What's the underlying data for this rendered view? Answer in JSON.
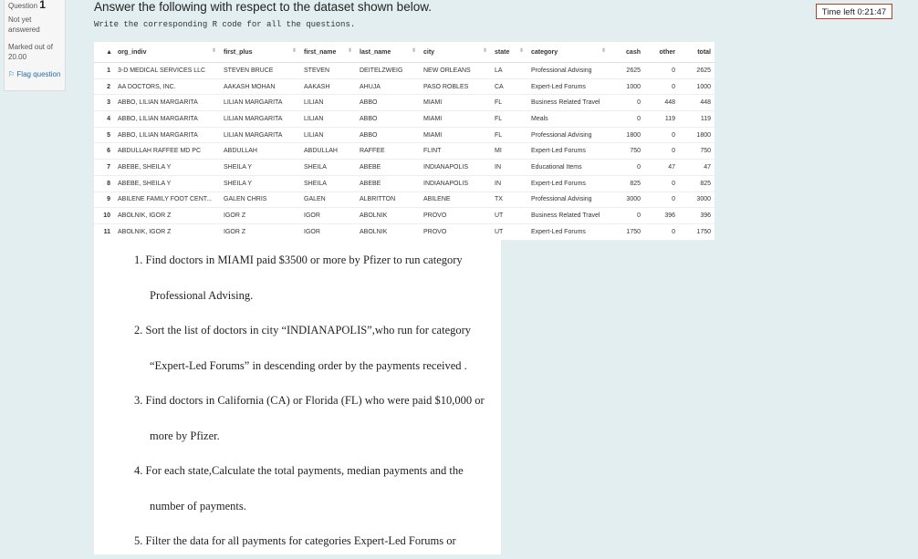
{
  "question_info": {
    "label": "Question",
    "number": "1",
    "status": "Not yet answered",
    "marks": "Marked out of 20.00",
    "flag": "Flag question"
  },
  "heading": "Answer the following with respect to the dataset shown below.",
  "subheading": "Write the corresponding R code for all the questions.",
  "timer": "Time left 0:21:47",
  "table": {
    "columns": [
      "org_indiv",
      "first_plus",
      "first_name",
      "last_name",
      "city",
      "state",
      "category",
      "cash",
      "other",
      "total"
    ],
    "rows": [
      [
        "1",
        "3-D MEDICAL SERVICES LLC",
        "STEVEN BRUCE",
        "STEVEN",
        "DEITELZWEIG",
        "NEW ORLEANS",
        "LA",
        "Professional Advising",
        "2625",
        "0",
        "2625"
      ],
      [
        "2",
        "AA DOCTORS, INC.",
        "AAKASH MOHAN",
        "AAKASH",
        "AHUJA",
        "PASO ROBLES",
        "CA",
        "Expert-Led Forums",
        "1000",
        "0",
        "1000"
      ],
      [
        "3",
        "ABBO, LILIAN MARGARITA",
        "LILIAN MARGARITA",
        "LILIAN",
        "ABBO",
        "MIAMI",
        "FL",
        "Business Related Travel",
        "0",
        "448",
        "448"
      ],
      [
        "4",
        "ABBO, LILIAN MARGARITA",
        "LILIAN MARGARITA",
        "LILIAN",
        "ABBO",
        "MIAMI",
        "FL",
        "Meals",
        "0",
        "119",
        "119"
      ],
      [
        "5",
        "ABBO, LILIAN MARGARITA",
        "LILIAN MARGARITA",
        "LILIAN",
        "ABBO",
        "MIAMI",
        "FL",
        "Professional Advising",
        "1800",
        "0",
        "1800"
      ],
      [
        "6",
        "ABDULLAH RAFFEE MD PC",
        "ABDULLAH",
        "ABDULLAH",
        "RAFFEE",
        "FLINT",
        "MI",
        "Expert-Led Forums",
        "750",
        "0",
        "750"
      ],
      [
        "7",
        "ABEBE, SHEILA Y",
        "SHEILA Y",
        "SHEILA",
        "ABEBE",
        "INDIANAPOLIS",
        "IN",
        "Educational Items",
        "0",
        "47",
        "47"
      ],
      [
        "8",
        "ABEBE, SHEILA Y",
        "SHEILA Y",
        "SHEILA",
        "ABEBE",
        "INDIANAPOLIS",
        "IN",
        "Expert-Led Forums",
        "825",
        "0",
        "825"
      ],
      [
        "9",
        "ABILENE FAMILY FOOT CENT...",
        "GALEN CHRIS",
        "GALEN",
        "ALBRITTON",
        "ABILENE",
        "TX",
        "Professional Advising",
        "3000",
        "0",
        "3000"
      ],
      [
        "10",
        "ABOLNIK, IGOR Z",
        "IGOR Z",
        "IGOR",
        "ABOLNIK",
        "PROVO",
        "UT",
        "Business Related Travel",
        "0",
        "396",
        "396"
      ],
      [
        "11",
        "ABOLNIK, IGOR Z",
        "IGOR Z",
        "IGOR",
        "ABOLNIK",
        "PROVO",
        "UT",
        "Expert-Led Forums",
        "1750",
        "0",
        "1750"
      ]
    ]
  },
  "questions": [
    "1. Find doctors in MIAMI paid $3500 or more by Pfizer to run category Professional Advising.",
    "2. Sort the list of doctors in city “INDIANAPOLIS”,who run for category “Expert-Led Forums” in descending order by the payments received .",
    "3. Find doctors in California (CA) or Florida (FL) who were paid $10,000 or more by Pfizer.",
    "4. For each state,Calculate the total payments, median payments and the number of payments.",
    "5. Filter the data for all payments for categories Expert-Led Forums or"
  ]
}
